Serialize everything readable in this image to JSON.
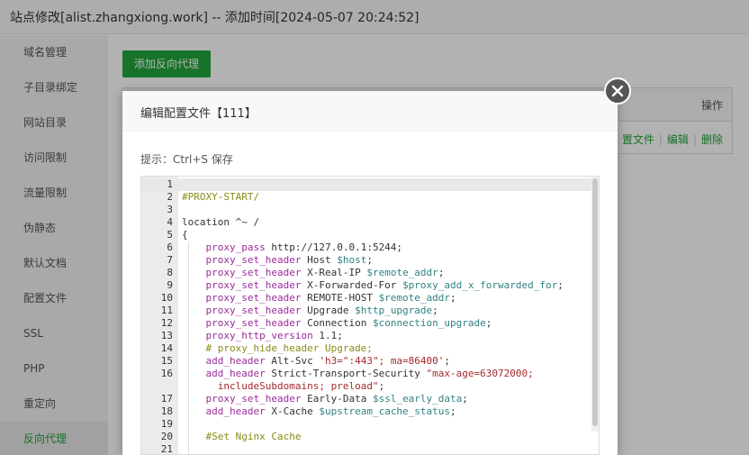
{
  "window": {
    "title": "站点修改[alist.zhangxiong.work] -- 添加时间[2024-05-07 20:24:52]"
  },
  "sidebar": {
    "items": [
      {
        "label": "域名管理"
      },
      {
        "label": "子目录绑定"
      },
      {
        "label": "网站目录"
      },
      {
        "label": "访问限制"
      },
      {
        "label": "流量限制"
      },
      {
        "label": "伪静态"
      },
      {
        "label": "默认文档"
      },
      {
        "label": "配置文件"
      },
      {
        "label": "SSL"
      },
      {
        "label": "PHP"
      },
      {
        "label": "重定向"
      },
      {
        "label": "反向代理"
      }
    ],
    "active": "反向代理"
  },
  "main": {
    "add_button": "添加反向代理",
    "table": {
      "op_header": "操作",
      "actions": [
        "置文件",
        "编辑",
        "删除"
      ]
    }
  },
  "dialog": {
    "title": "编辑配置文件【111】",
    "hint": "提示：Ctrl+S 保存",
    "code_lines": [
      {
        "n": "1",
        "html": ""
      },
      {
        "n": "2",
        "html": "<span class=\"c\">#PROXY-START/</span>"
      },
      {
        "n": "3",
        "html": ""
      },
      {
        "n": "4",
        "html": "location ^~ /"
      },
      {
        "n": "5",
        "html": "{"
      },
      {
        "n": "6",
        "html": "    <span class=\"k\">proxy_pass</span> http://127.0.0.1:5244;"
      },
      {
        "n": "7",
        "html": "    <span class=\"k\">proxy_set_header</span> Host <span class=\"v\">$host</span>;"
      },
      {
        "n": "8",
        "html": "    <span class=\"k\">proxy_set_header</span> X-Real-IP <span class=\"v\">$remote_addr</span>;"
      },
      {
        "n": "9",
        "html": "    <span class=\"k\">proxy_set_header</span> X-Forwarded-For <span class=\"v\">$proxy_add_x_forwarded_for</span>;"
      },
      {
        "n": "10",
        "html": "    <span class=\"k\">proxy_set_header</span> REMOTE-HOST <span class=\"v\">$remote_addr</span>;"
      },
      {
        "n": "11",
        "html": "    <span class=\"k\">proxy_set_header</span> Upgrade <span class=\"v\">$http_upgrade</span>;"
      },
      {
        "n": "12",
        "html": "    <span class=\"k\">proxy_set_header</span> Connection <span class=\"v\">$connection_upgrade</span>;"
      },
      {
        "n": "13",
        "html": "    <span class=\"k\">proxy_http_version</span> 1.1;"
      },
      {
        "n": "14",
        "html": "    <span class=\"c\"># proxy_hide_header Upgrade;</span>"
      },
      {
        "n": "15",
        "html": "    <span class=\"k\">add_header</span> Alt-Svc <span class=\"s\">'h3=\":443\"; ma=86400'</span>;"
      },
      {
        "n": "16",
        "html": "    <span class=\"k\">add_header</span> Strict-Transport-Security <span class=\"s\">\"max-age=63072000;</span>"
      },
      {
        "n": "",
        "html": "      <span class=\"s\">includeSubdomains; preload\"</span>;"
      },
      {
        "n": "17",
        "html": "    <span class=\"k\">proxy_set_header</span> Early-Data <span class=\"v\">$ssl_early_data</span>;"
      },
      {
        "n": "18",
        "html": "    <span class=\"k\">add_header</span> X-Cache <span class=\"v\">$upstream_cache_status</span>;"
      },
      {
        "n": "19",
        "html": ""
      },
      {
        "n": "20",
        "html": "    <span class=\"c\">#Set Nginx Cache</span>"
      },
      {
        "n": "21",
        "html": ""
      }
    ]
  }
}
